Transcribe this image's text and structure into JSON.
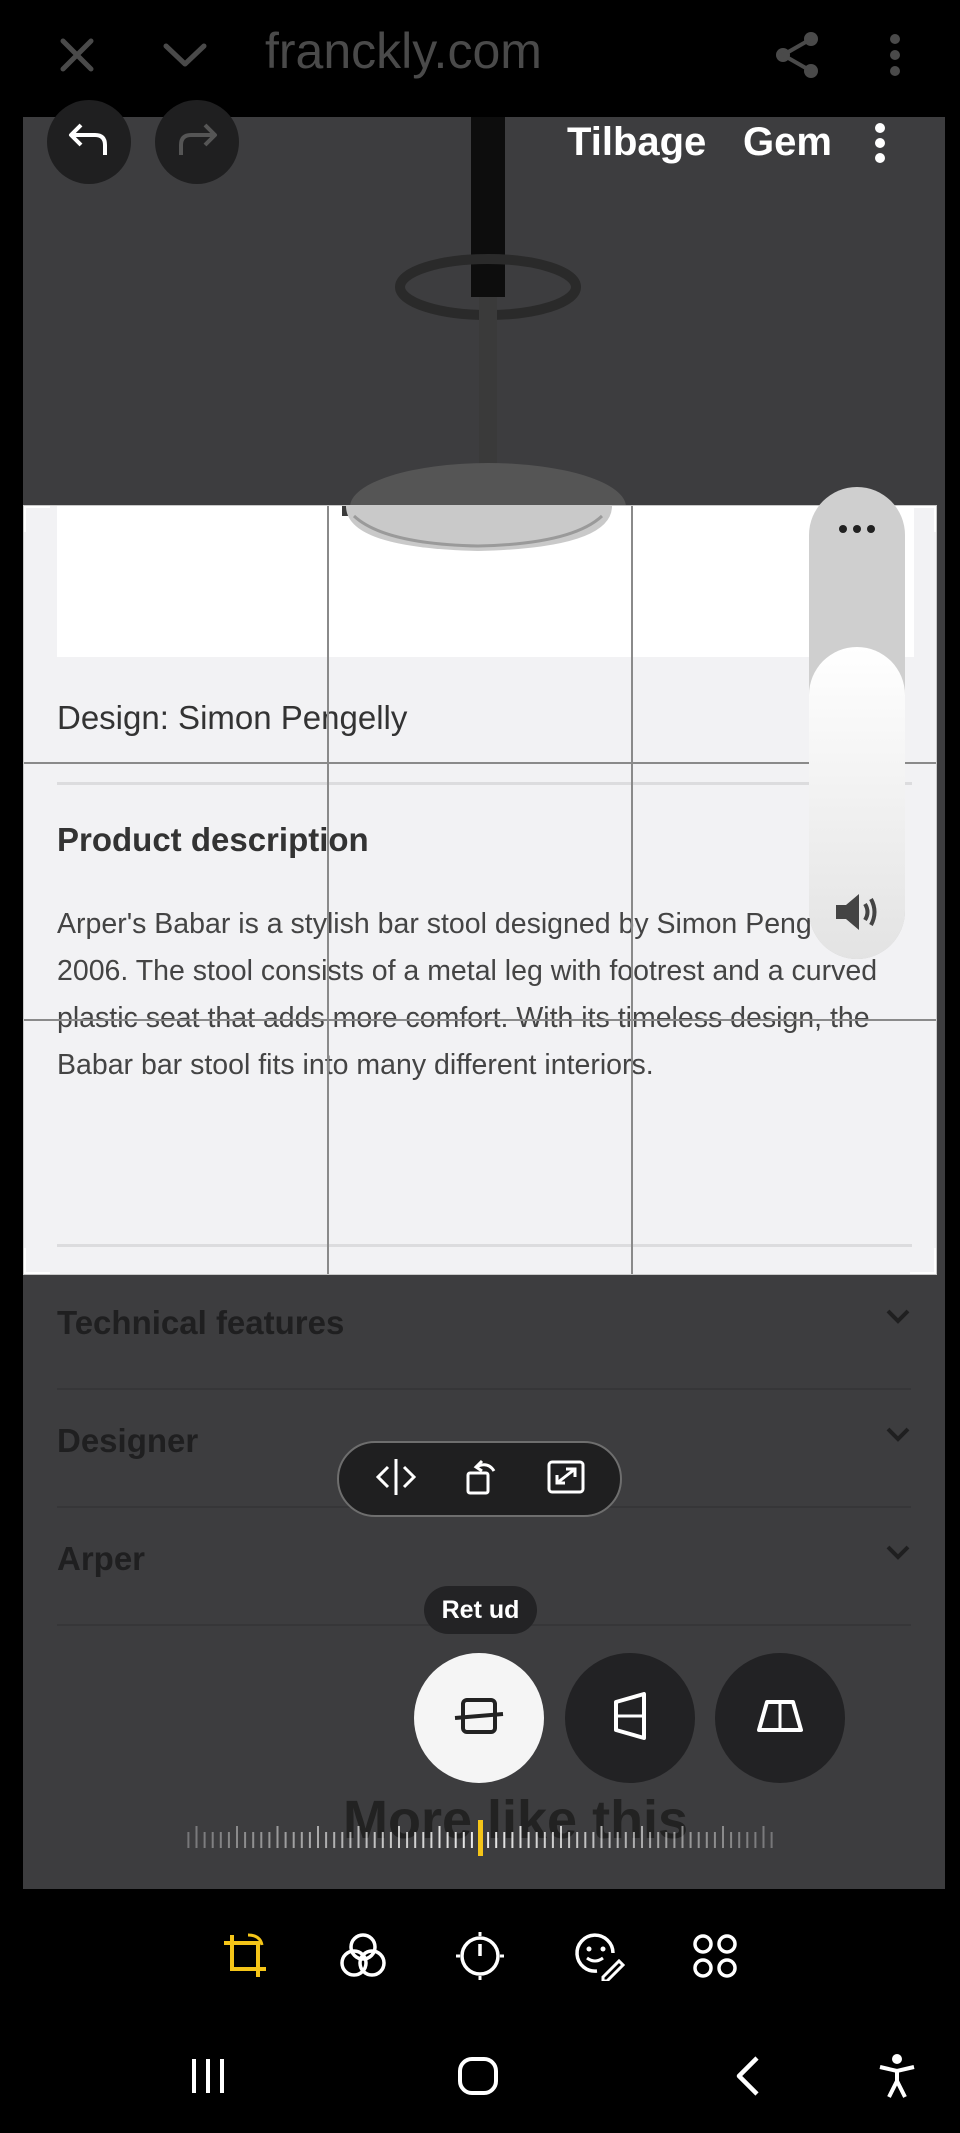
{
  "browser": {
    "url": "franckly.com",
    "icons": [
      "close-icon",
      "chevron-down-icon",
      "share-icon",
      "more-vert-icon"
    ]
  },
  "editor": {
    "undo_icon": "undo-icon",
    "redo_icon": "redo-icon",
    "cancel_label": "Tilbage",
    "save_label": "Gem",
    "more_icon": "more-vert-icon"
  },
  "page": {
    "design_line": "Design: Simon Pengelly",
    "product_description_title": "Product description",
    "product_description_text": "Arper's Babar is a stylish bar stool designed by Simon Pengelly in 2006. The stool consists of a metal leg with footrest and a curved plastic seat that adds more comfort. With its timeless design, the Babar bar stool fits into many different interiors.",
    "sections": [
      {
        "label": "Technical features"
      },
      {
        "label": "Designer"
      },
      {
        "label": "Arper"
      }
    ],
    "more_like_this": "More like this"
  },
  "volume": {
    "level": 0.66,
    "icons": [
      "more-horiz-icon",
      "speaker-icon"
    ]
  },
  "transform_tools": [
    "flip-icon",
    "rotate-icon",
    "expand-icon"
  ],
  "perspective": {
    "tooltip": "Ret ud",
    "buttons": [
      "straighten-icon",
      "vertical-perspective-icon",
      "horizontal-perspective-icon"
    ],
    "active_index": 0
  },
  "bottom_toolbar": {
    "items": [
      "crop-rotate-icon",
      "filters-icon",
      "adjust-icon",
      "decorations-icon",
      "more-tools-icon"
    ],
    "active_index": 0,
    "accent_color": "#f5c518"
  },
  "nav_bar": [
    "recents-icon",
    "home-icon",
    "back-icon",
    "accessibility-icon"
  ]
}
